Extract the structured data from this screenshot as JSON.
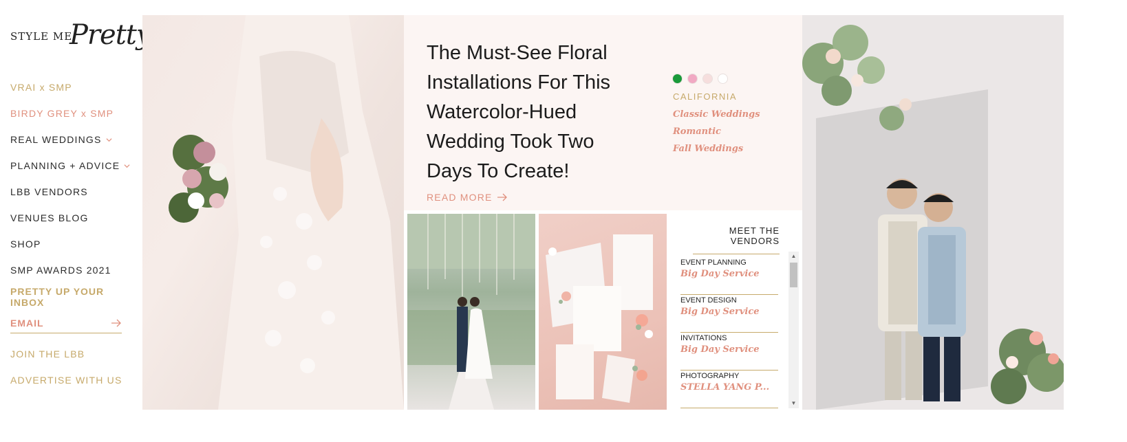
{
  "logo": {
    "caps": "STYLE ME",
    "script": "Pretty"
  },
  "sidebar": {
    "items": [
      {
        "label": "VRAI x SMP",
        "color": "#c6a96a"
      },
      {
        "label": "BIRDY GREY x SMP",
        "color": "#e0907e"
      },
      {
        "label": "REAL WEDDINGS",
        "icon": "chevron-down-icon"
      },
      {
        "label": "PLANNING + ADVICE",
        "icon": "chevron-down-icon"
      },
      {
        "label": "LBB VENDORS"
      },
      {
        "label": "VENUES BLOG"
      },
      {
        "label": "SHOP"
      },
      {
        "label": "SMP AWARDS 2021"
      }
    ],
    "newsletter": {
      "heading": "PRETTY UP YOUR INBOX",
      "email_placeholder": "EMAIL",
      "submit_icon": "arrow-right-icon"
    },
    "bottom_items": [
      {
        "label": "JOIN THE LBB"
      },
      {
        "label": "ADVERTISE WITH US"
      }
    ]
  },
  "feature": {
    "title": "The Must-See Floral Installations For This Watercolor-Hued Wedding Took Two Days To Create!",
    "read_more": "READ MORE",
    "palette": [
      "#1a9a3a",
      "#f1a9c3",
      "#f6dedd",
      "#ffffff"
    ],
    "location": "CALIFORNIA",
    "tags": [
      "Classic Weddings",
      "Romantic",
      "Fall Weddings"
    ]
  },
  "vendors": {
    "title": "MEET THE VENDORS",
    "items": [
      {
        "category": "EVENT PLANNING",
        "name": "Big Day Service"
      },
      {
        "category": "EVENT DESIGN",
        "name": "Big Day Service"
      },
      {
        "category": "INVITATIONS",
        "name": "Big Day Service"
      },
      {
        "category": "PHOTOGRAPHY",
        "name": "STELLA YANG P..."
      }
    ]
  },
  "colors": {
    "gold": "#c6a96a",
    "pink": "#e0907e",
    "feature_bg": "#fcf5f3"
  }
}
